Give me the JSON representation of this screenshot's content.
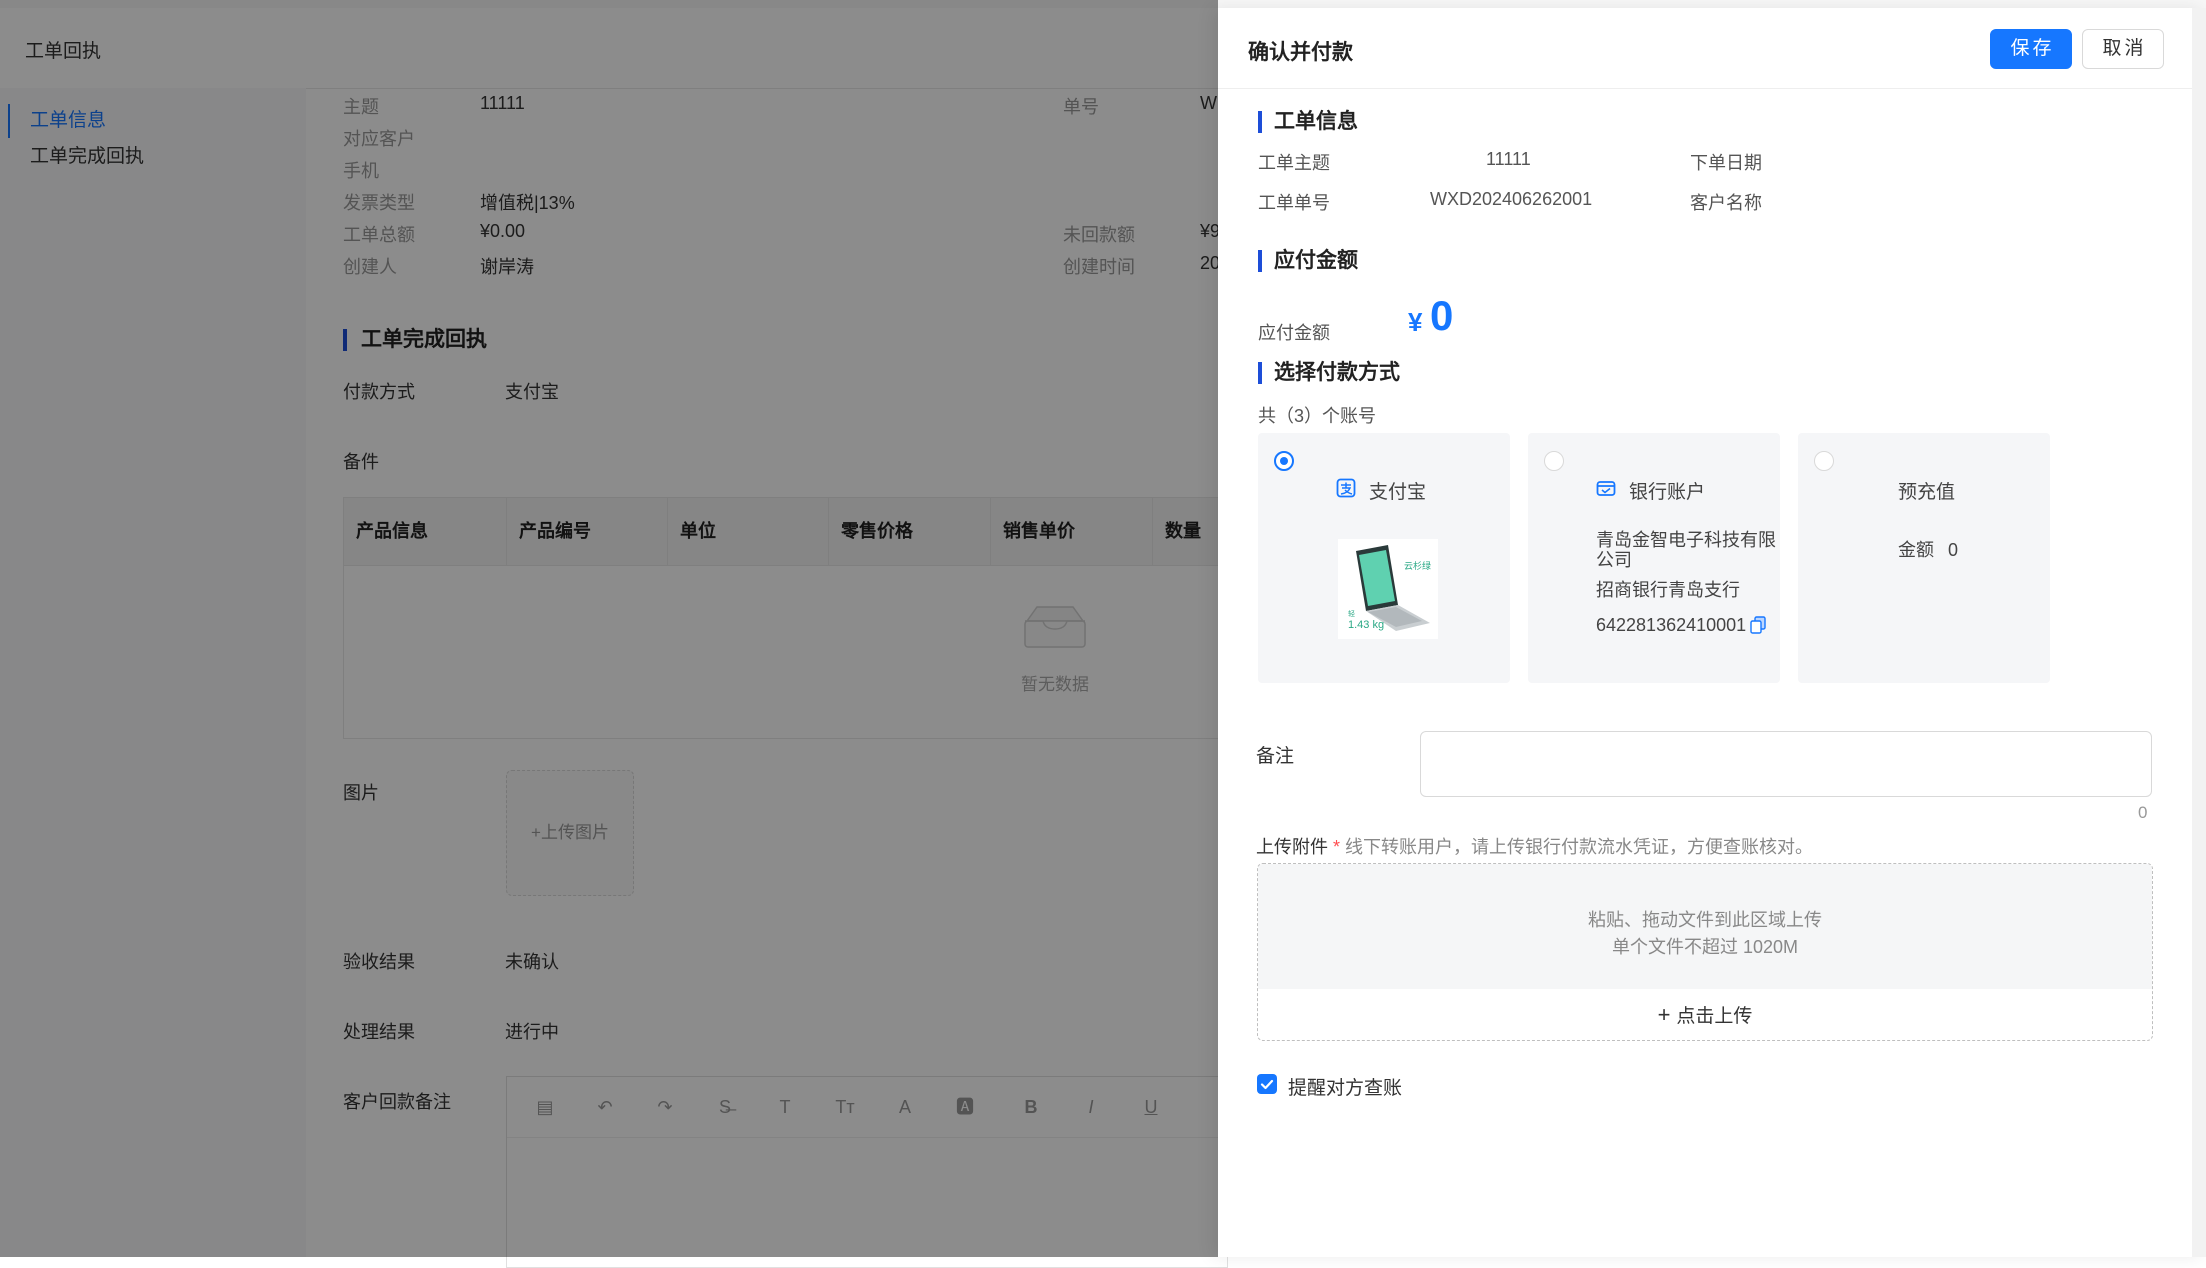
{
  "background": {
    "header_title": "工单回执",
    "nav": [
      {
        "label": "工单信息",
        "active": true
      },
      {
        "label": "工单完成回执",
        "active": false
      }
    ],
    "fields_left": [
      {
        "label": "主题",
        "value": "11111"
      },
      {
        "label": "对应客户",
        "value": ""
      },
      {
        "label": "手机",
        "value": ""
      },
      {
        "label": "发票类型",
        "value": "增值税|13%"
      },
      {
        "label": "工单总额",
        "value": "¥0.00"
      },
      {
        "label": "创建人",
        "value": "谢岸涛"
      }
    ],
    "fields_right": [
      {
        "label": "单号",
        "value": "W"
      },
      {
        "label": "未回款额",
        "value": "¥9"
      },
      {
        "label": "创建时间",
        "value": "20"
      }
    ],
    "section_title": "工单完成回执",
    "payment_method": {
      "label": "付款方式",
      "value": "支付宝"
    },
    "parts_label": "备件",
    "table_headers": [
      "产品信息",
      "产品编号",
      "单位",
      "零售价格",
      "销售单价",
      "数量"
    ],
    "empty_text": "暂无数据",
    "images_label": "图片",
    "upload_image_text": "+上传图片",
    "acceptance": {
      "label": "验收结果",
      "value": "未确认"
    },
    "processing": {
      "label": "处理结果",
      "value": "进行中"
    },
    "customer_remark_label": "客户回款备注",
    "toolbar_icons": [
      "table-icon",
      "undo-icon",
      "redo-icon",
      "strikethrough-icon",
      "text-icon",
      "text-size-icon",
      "font-color-icon",
      "background-color-icon",
      "bold-icon",
      "italic-icon",
      "underline-icon"
    ],
    "toolbar_glyphs": [
      "▤",
      "↶",
      "↷",
      "S̶",
      "T",
      "Tт",
      "A",
      "🅰",
      "B",
      "I",
      "U"
    ]
  },
  "drawer": {
    "title": "确认并付款",
    "save_label": "保存",
    "cancel_label": "取消",
    "order_section": "工单信息",
    "order_subject_label": "工单主题",
    "order_subject_value": "11111",
    "order_date_label": "下单日期",
    "order_no_label": "工单单号",
    "order_no_value": "WXD202406262001",
    "customer_label": "客户名称",
    "amount_section": "应付金额",
    "amount_label": "应付金额",
    "amount_currency": "¥",
    "amount_value": "0",
    "payment_section": "选择付款方式",
    "account_count_text": "共（3）个账号",
    "methods": {
      "alipay": {
        "name": "支付宝",
        "selected": true,
        "qr_text": "云杉绿",
        "qr_weight": "1.43 kg",
        "qr_small": "轻"
      },
      "bank": {
        "name": "银行账户",
        "selected": false,
        "company_line1": "青岛金智电子科技有限",
        "company_line2": "公司",
        "bank_name": "招商银行青岛支行",
        "account_no": "642281362410001"
      },
      "prepaid": {
        "name": "预充值",
        "selected": false,
        "balance_label": "金额",
        "balance_value": "0"
      }
    },
    "remark_label": "备注",
    "remark_value": "",
    "remark_count": "0",
    "upload_label": "上传附件",
    "upload_required": "*",
    "upload_hint": "线下转账用户，请上传银行付款流水凭证，方便查账核对。",
    "dropzone_line1": "粘贴、拖动文件到此区域上传",
    "dropzone_line2": "单个文件不超过 1020M",
    "upload_button": "点击上传",
    "notify_label": "提醒对方查账",
    "notify_checked": true
  },
  "colors": {
    "primary": "#1677ff",
    "section_bar": "#1d4ed8"
  }
}
